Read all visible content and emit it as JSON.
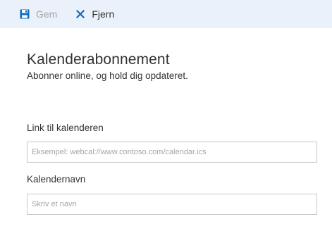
{
  "toolbar": {
    "save_label": "Gem",
    "remove_label": "Fjern",
    "save_icon": "floppy-disk-icon",
    "remove_icon": "x-close-icon"
  },
  "header": {
    "title": "Kalenderabonnement",
    "subtitle": "Abonner online, og hold dig opdateret."
  },
  "form": {
    "link_label": "Link til kalenderen",
    "link_value": "",
    "link_placeholder": "Eksempel: webcal://www.contoso.com/calendar.ics",
    "name_label": "Kalendernavn",
    "name_value": "",
    "name_placeholder": "Skriv et navn"
  },
  "colors": {
    "toolbar_bg": "#eaf1fb",
    "accent": "#0f6cbd",
    "disabled_text": "#a6a6a6"
  }
}
